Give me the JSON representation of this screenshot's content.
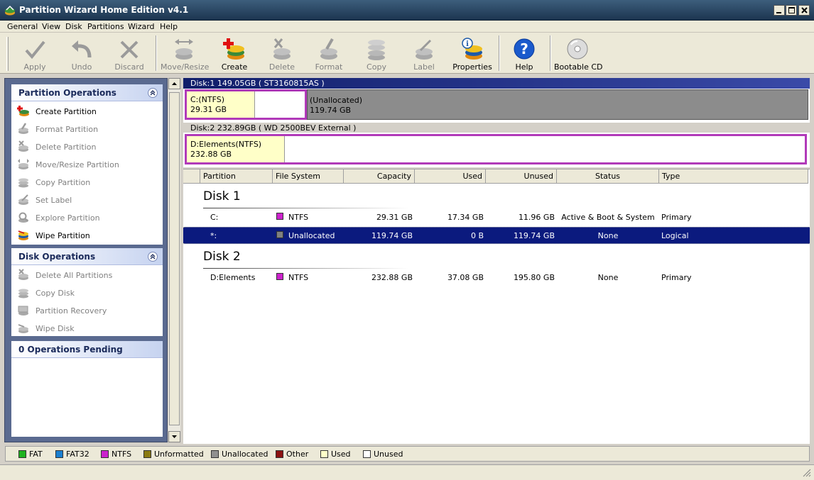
{
  "window": {
    "title": "Partition Wizard Home Edition v4.1"
  },
  "menu": [
    "General",
    "View",
    "Disk",
    "Partitions",
    "Wizard",
    "Help"
  ],
  "toolbar": {
    "apply": "Apply",
    "undo": "Undo",
    "discard": "Discard",
    "move_resize": "Move/Resize",
    "create": "Create",
    "delete": "Delete",
    "format": "Format",
    "copy": "Copy",
    "label": "Label",
    "properties": "Properties",
    "help": "Help",
    "bootable_cd": "Bootable CD"
  },
  "sidebar": {
    "partition_ops": {
      "title": "Partition Operations",
      "items": [
        "Create Partition",
        "Format Partition",
        "Delete Partition",
        "Move/Resize Partition",
        "Copy Partition",
        "Set Label",
        "Explore Partition",
        "Wipe Partition"
      ]
    },
    "disk_ops": {
      "title": "Disk Operations",
      "items": [
        "Delete All Partitions",
        "Copy Disk",
        "Partition Recovery",
        "Wipe Disk"
      ]
    },
    "pending": {
      "title": "0 Operations Pending"
    }
  },
  "diskmap": {
    "disk1": {
      "header": "Disk:1 149.05GB ( ST3160815AS )",
      "c_name": "C:(NTFS)",
      "c_size": "29.31 GB",
      "u_name": "(Unallocated)",
      "u_size": "119.74 GB"
    },
    "disk2": {
      "header": "Disk:2 232.89GB ( WD 2500BEV External )",
      "d_name": "D:Elements(NTFS)",
      "d_size": "232.88 GB"
    }
  },
  "table": {
    "columns": [
      "Partition",
      "File System",
      "Capacity",
      "Used",
      "Unused",
      "Status",
      "Type"
    ],
    "groups": [
      {
        "title": "Disk 1",
        "rows": [
          {
            "partition": "C:",
            "fs": "NTFS",
            "capacity": "29.31 GB",
            "used": "17.34 GB",
            "unused": "11.96 GB",
            "status": "Active & Boot & System",
            "type": "Primary"
          },
          {
            "partition": "*:",
            "fs": "Unallocated",
            "capacity": "119.74 GB",
            "used": "0 B",
            "unused": "119.74 GB",
            "status": "None",
            "type": "Logical"
          }
        ]
      },
      {
        "title": "Disk 2",
        "rows": [
          {
            "partition": "D:Elements",
            "fs": "NTFS",
            "capacity": "232.88 GB",
            "used": "37.08 GB",
            "unused": "195.80 GB",
            "status": "None",
            "type": "Primary"
          }
        ]
      }
    ]
  },
  "legend": [
    {
      "label": "FAT",
      "color": "#1fb31f"
    },
    {
      "label": "FAT32",
      "color": "#1a7fd0"
    },
    {
      "label": "NTFS",
      "color": "#cc22cc"
    },
    {
      "label": "Unformatted",
      "color": "#8a7a10"
    },
    {
      "label": "Unallocated",
      "color": "#909090"
    },
    {
      "label": "Other",
      "color": "#8b1010"
    },
    {
      "label": "Used",
      "color": "#ffffc8"
    },
    {
      "label": "Unused",
      "color": "#ffffff"
    }
  ],
  "colors": {
    "ntfs": "#cc22cc",
    "unallocated": "#808080",
    "selection": "#0b1a7e",
    "used_fill": "#ffffc8"
  }
}
